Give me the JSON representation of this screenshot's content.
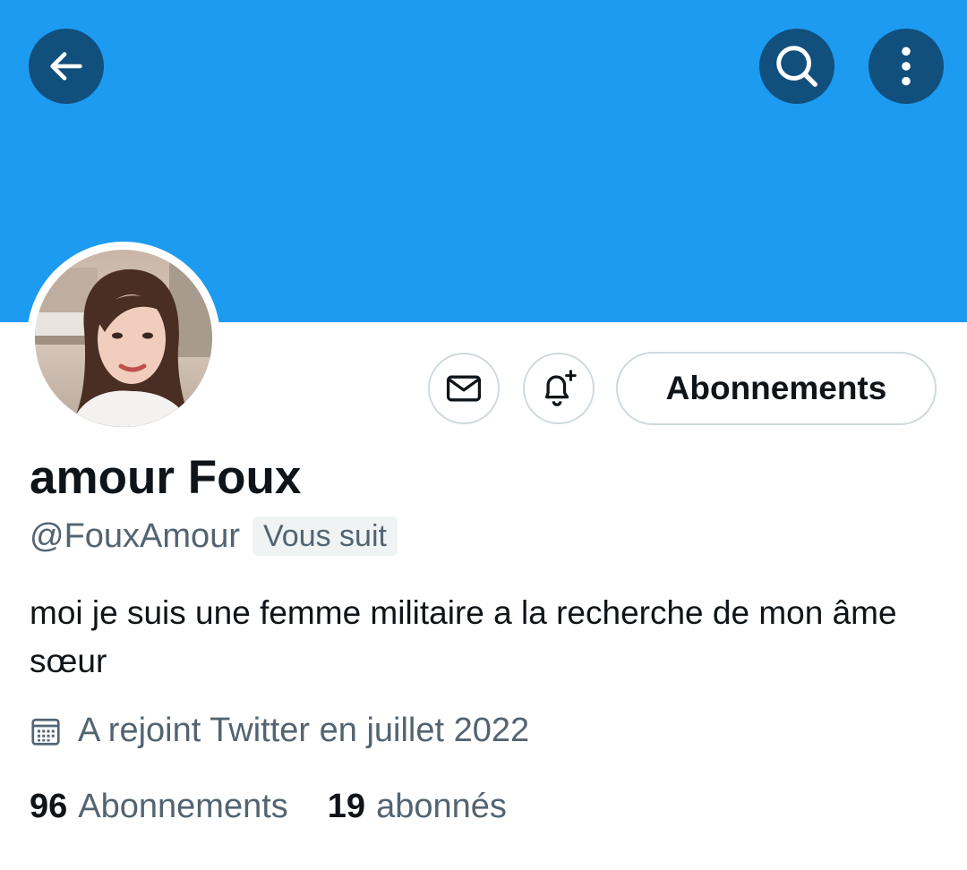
{
  "header": {
    "banner_color": "#1d9bf0",
    "button_color": "#114f7d",
    "back_icon": "arrow-left-icon",
    "search_icon": "search-icon",
    "more_icon": "more-vertical-icon"
  },
  "profile": {
    "display_name": "amour Foux",
    "handle": "@FouxAmour",
    "follows_you_badge": "Vous suit",
    "bio": "moi je suis une femme militaire a la recherche de mon âme sœur",
    "joined": "A rejoint Twitter en juillet 2022",
    "joined_icon": "calendar-icon"
  },
  "actions": {
    "message_icon": "mail-icon",
    "notify_icon": "bell-plus-icon",
    "following_button_label": "Abonnements"
  },
  "stats": {
    "following_count": "96",
    "following_label": "Abonnements",
    "followers_count": "19",
    "followers_label": "abonnés"
  }
}
